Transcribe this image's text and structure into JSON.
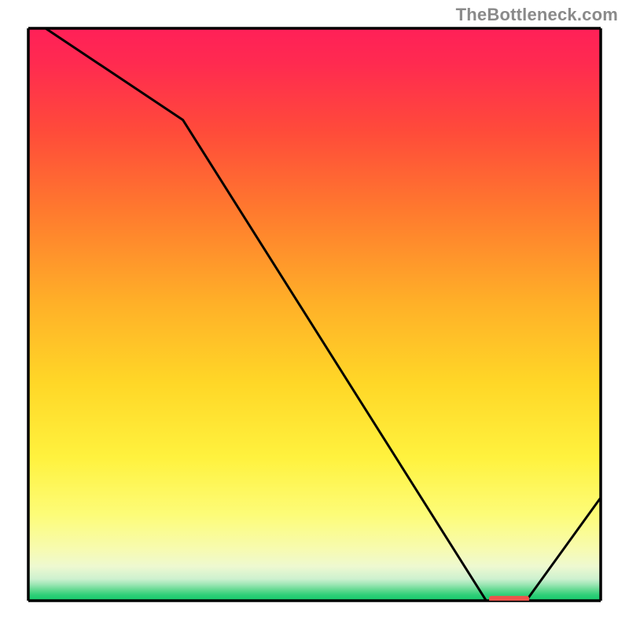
{
  "watermark": "TheBottleneck.com",
  "chart_data": {
    "type": "line",
    "title": "",
    "xlabel": "",
    "ylabel": "",
    "xlim": [
      0,
      100
    ],
    "ylim": [
      0,
      100
    ],
    "x": [
      0,
      3,
      27,
      80,
      87,
      100
    ],
    "values": [
      100,
      100,
      84,
      0,
      0,
      18
    ],
    "annotations": [],
    "background_bands": [
      {
        "name": "green",
        "y0": 0,
        "y1": 2.5,
        "comment": "very thin strip"
      },
      {
        "name": "yellow",
        "y0": 2.5,
        "y1": 18
      },
      {
        "name": "red",
        "y0": 18,
        "y1": 100
      }
    ],
    "marker_segment": {
      "x0": 80.5,
      "x1": 87.5,
      "y": 0.3,
      "color": "#ee544b"
    }
  }
}
